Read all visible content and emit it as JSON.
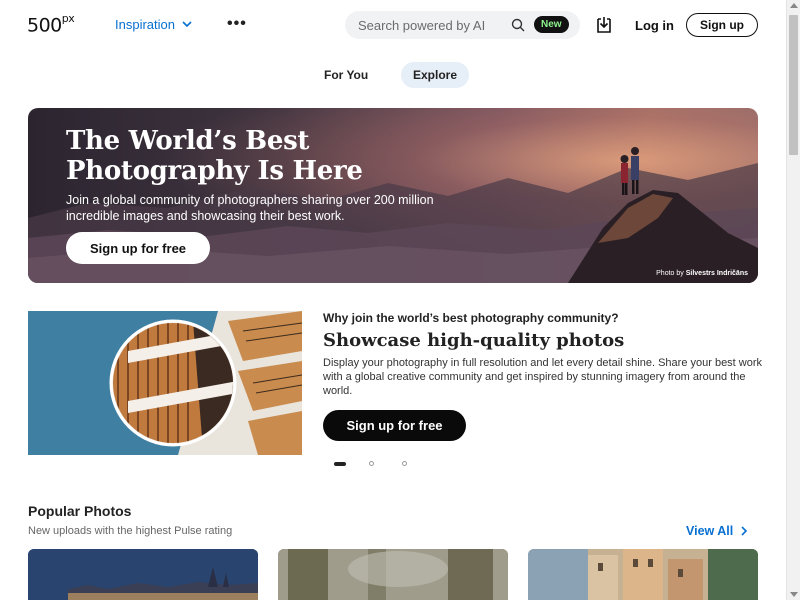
{
  "header": {
    "logo": "500",
    "logo_suffix": "px",
    "nav_inspiration": "Inspiration",
    "more_label": "•••",
    "search_placeholder": "Search powered by AI",
    "badge_new": "New",
    "login": "Log in",
    "signup": "Sign up"
  },
  "tabs": [
    {
      "label": "For You",
      "active": false
    },
    {
      "label": "Explore",
      "active": true
    }
  ],
  "hero": {
    "title_line1": "The World’s Best",
    "title_line2": "Photography Is Here",
    "subtitle": "Join a global community of photographers sharing over 200 million incredible images and showcasing their best work.",
    "cta": "Sign up for free",
    "credit_prefix": "Photo by",
    "credit_name": "Silvestrs Indričāns"
  },
  "feature": {
    "heading": "Why join the world’s best photography community?",
    "title": "Showcase high-quality photos",
    "description": "Display your photography in full resolution and let every detail shine. Share your best work with a global creative community and get inspired by stunning imagery from around the world.",
    "cta": "Sign up for free",
    "slides_total": 3,
    "slide_active": 1
  },
  "popular": {
    "title": "Popular Photos",
    "subtitle": "New uploads with the highest Pulse rating",
    "view_all": "View All"
  },
  "colors": {
    "link_blue": "#0870d1",
    "new_badge_text": "#8cf08c",
    "explore_tab_bg": "#e6eef7"
  }
}
